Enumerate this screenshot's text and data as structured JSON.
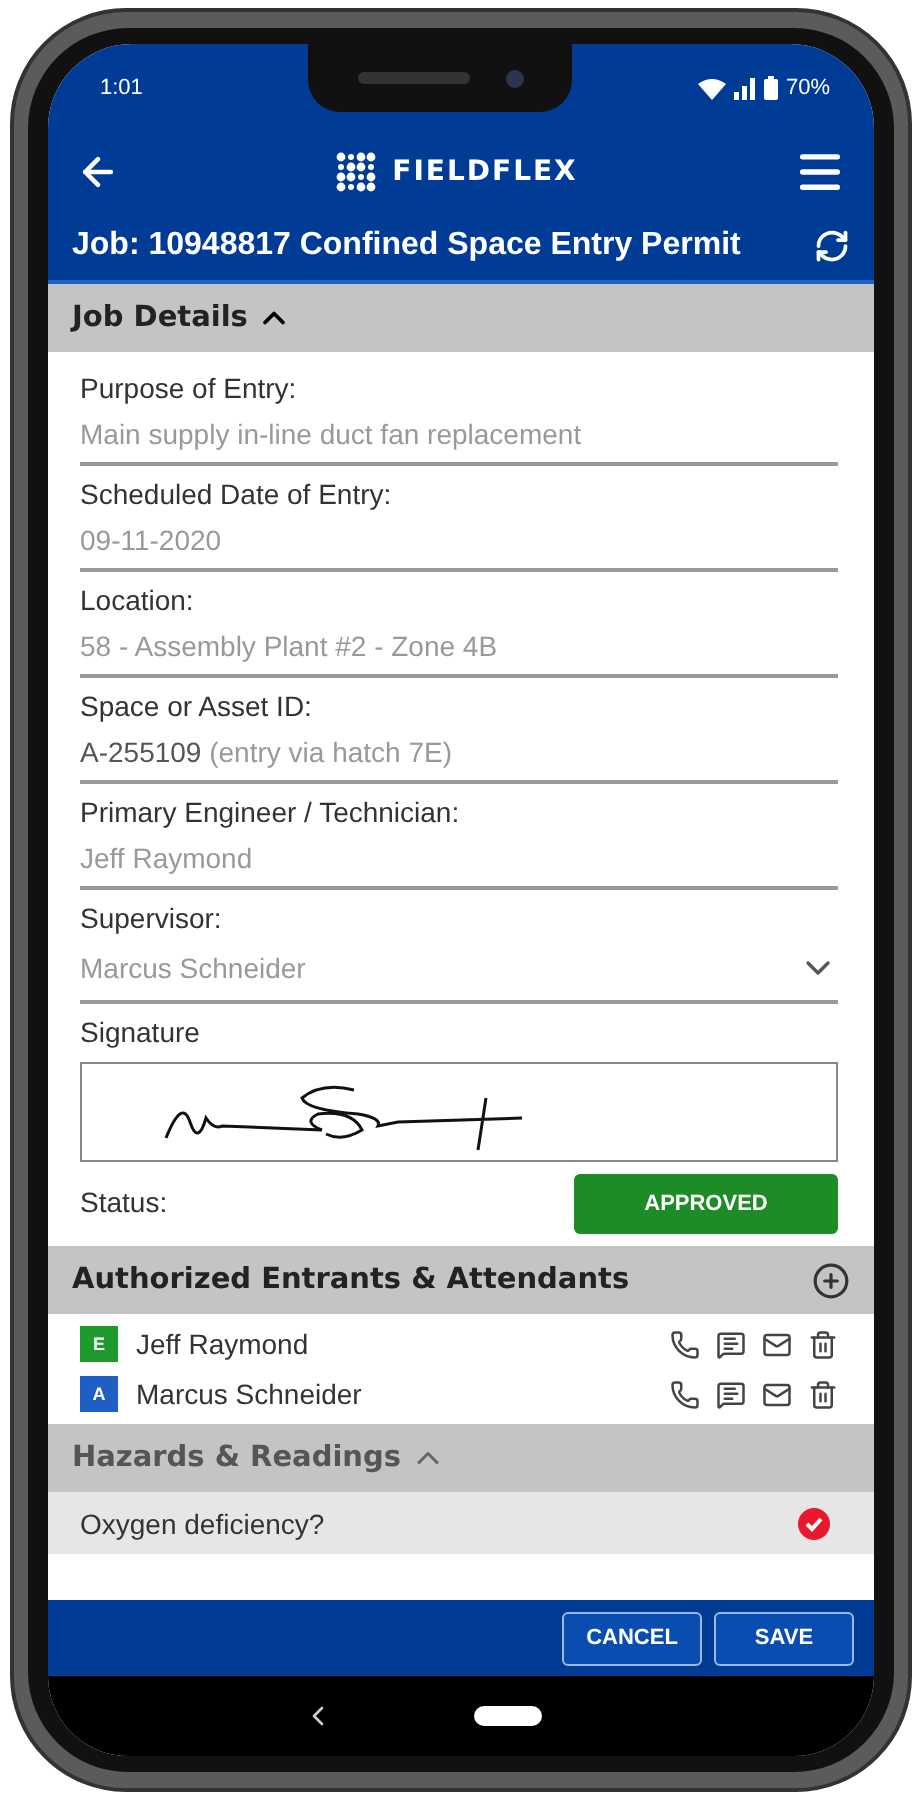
{
  "status_bar": {
    "time": "1:01",
    "battery": "70%"
  },
  "header": {
    "brand": "FIELDFLEX",
    "title": "Job: 10948817 Confined Space Entry Permit"
  },
  "job_details": {
    "title": "Job Details",
    "expanded": true,
    "fields": [
      {
        "kind": "text",
        "label": "Purpose of Entry:",
        "value": "Main supply in-line duct fan replacement"
      },
      {
        "kind": "text",
        "label": "Scheduled Date of Entry:",
        "value": "09-11-2020"
      },
      {
        "kind": "text",
        "label": "Location:",
        "value": "58 - Assembly Plant #2 - Zone 4B"
      },
      {
        "kind": "text",
        "label": "Space or Asset ID:",
        "value": "A-255109",
        "note": "(entry via hatch 7E)"
      },
      {
        "kind": "text",
        "label": "Primary Engineer / Technician:",
        "value": "Jeff Raymond"
      },
      {
        "kind": "select",
        "label": "Supervisor:",
        "value": "Marcus Schneider"
      }
    ],
    "signature_label": "Signature",
    "status_label": "Status:",
    "status": "APPROVED"
  },
  "entrants": {
    "title": "Authorized Entrants & Attendants",
    "items": [
      {
        "role": "E",
        "color": "#1e9a2e",
        "name": "Jeff Raymond"
      },
      {
        "role": "A",
        "color": "#1f5fc4",
        "name": "Marcus Schneider"
      }
    ]
  },
  "hazards": {
    "title": "Hazards & Readings",
    "expanded": true,
    "items": [
      {
        "label": "Oxygen deficiency?",
        "checked": true
      }
    ]
  },
  "footer": {
    "buttons": [
      "CANCEL",
      "SAVE"
    ]
  }
}
